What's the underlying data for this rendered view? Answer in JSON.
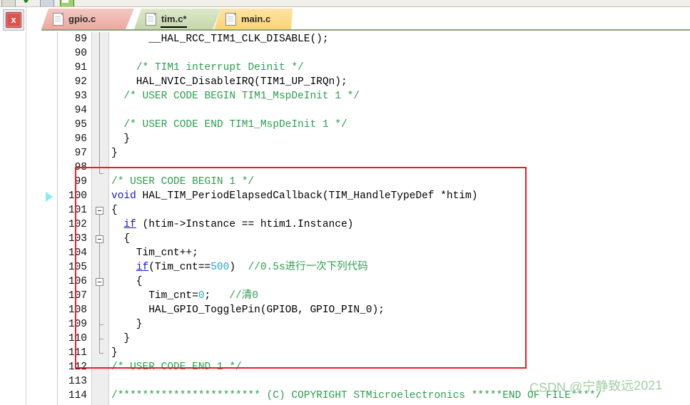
{
  "window": {
    "close_label": "x"
  },
  "toolbar": {
    "icons": [
      "save-icon",
      "check-icon",
      "document-icon",
      "build-icon"
    ]
  },
  "tabs": [
    {
      "label": "gpio.c",
      "icon": "file-icon",
      "active": false,
      "color": "#eba9a0"
    },
    {
      "label": "tim.c*",
      "icon": "file-icon",
      "active": true,
      "color": "#c5d6ab"
    },
    {
      "label": "main.c",
      "icon": "file-icon",
      "active": false,
      "color": "#fbd477"
    }
  ],
  "editor": {
    "active_file": "tim.c*",
    "bookmark_line": 100,
    "first_line": 89,
    "last_line": 114,
    "lines": [
      {
        "n": "89",
        "text": "      __HAL_RCC_TIM1_CLK_DISABLE();"
      },
      {
        "n": "90",
        "text": ""
      },
      {
        "n": "91",
        "text": "    /* TIM1 interrupt Deinit */"
      },
      {
        "n": "92",
        "text": "    HAL_NVIC_DisableIRQ(TIM1_UP_IRQn);"
      },
      {
        "n": "93",
        "text": "  /* USER CODE BEGIN TIM1_MspDeInit 1 */"
      },
      {
        "n": "94",
        "text": ""
      },
      {
        "n": "95",
        "text": "  /* USER CODE END TIM1_MspDeInit 1 */"
      },
      {
        "n": "96",
        "text": "  }"
      },
      {
        "n": "97",
        "text": "}"
      },
      {
        "n": "98",
        "text": ""
      },
      {
        "n": "99",
        "text": "/* USER CODE BEGIN 1 */"
      },
      {
        "n": "100",
        "text": "void HAL_TIM_PeriodElapsedCallback(TIM_HandleTypeDef *htim)"
      },
      {
        "n": "101",
        "text": "{"
      },
      {
        "n": "102",
        "text": "  if (htim->Instance == htim1.Instance)"
      },
      {
        "n": "103",
        "text": "  {"
      },
      {
        "n": "104",
        "text": "    Tim_cnt++;"
      },
      {
        "n": "105",
        "text": "    if(Tim_cnt==500)  //0.5s进行一次下列代码"
      },
      {
        "n": "106",
        "text": "    {"
      },
      {
        "n": "107",
        "text": "      Tim_cnt=0;   //清0"
      },
      {
        "n": "108",
        "text": "      HAL_GPIO_TogglePin(GPIOB, GPIO_PIN_0);"
      },
      {
        "n": "109",
        "text": "    }"
      },
      {
        "n": "110",
        "text": "  }"
      },
      {
        "n": "111",
        "text": "}"
      },
      {
        "n": "112",
        "text": "/* USER CODE END 1 */"
      },
      {
        "n": "113",
        "text": ""
      },
      {
        "n": "114",
        "text": "/*********************** (C) COPYRIGHT STMicroelectronics *****END OF FILE****/"
      }
    ]
  },
  "annotation": {
    "shape": "rectangle",
    "color": "#ee1c23",
    "covers_lines": "99-112"
  },
  "watermark": {
    "text": "CSDN @宁静致远2021",
    "color": "#9ecb9e"
  }
}
